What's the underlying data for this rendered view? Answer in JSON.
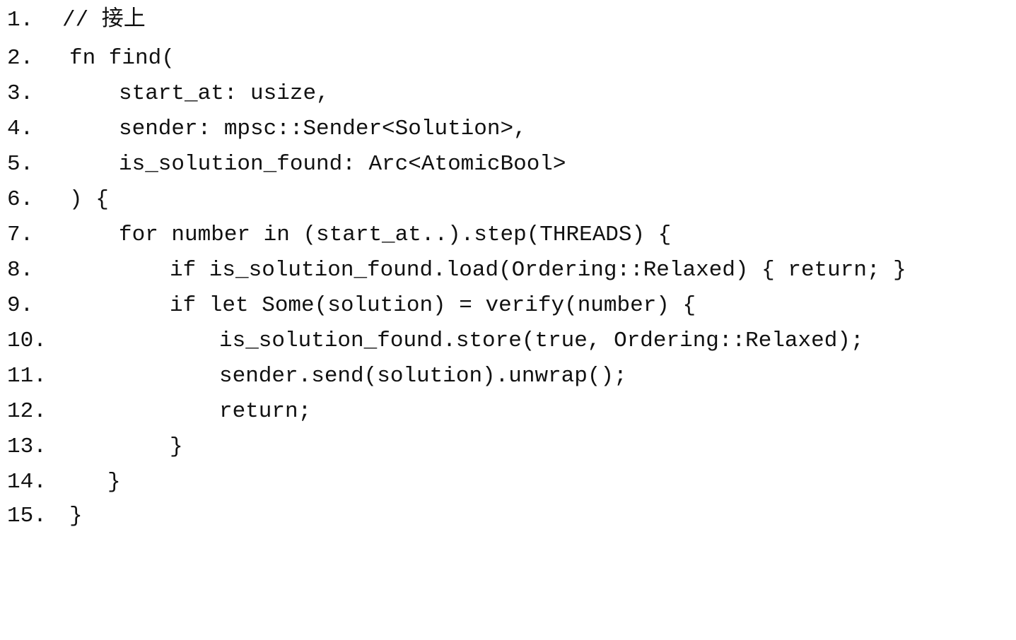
{
  "listing": {
    "lines": [
      {
        "number": "1.",
        "code": "// 接上"
      },
      {
        "number": "2.",
        "code": "fn find("
      },
      {
        "number": "3.",
        "code": "start_at: usize,"
      },
      {
        "number": "4.",
        "code": "sender: mpsc::Sender<Solution>,"
      },
      {
        "number": "5.",
        "code": "is_solution_found: Arc<AtomicBool>"
      },
      {
        "number": "6.",
        "code": ") {"
      },
      {
        "number": "7.",
        "code": "for number in (start_at..).step(THREADS) {"
      },
      {
        "number": "8.",
        "code": "if is_solution_found.load(Ordering::Relaxed) { return; }"
      },
      {
        "number": "9.",
        "code": "if let Some(solution) = verify(number) {"
      },
      {
        "number": "10.",
        "code": "is_solution_found.store(true, Ordering::Relaxed);"
      },
      {
        "number": "11.",
        "code": "sender.send(solution).unwrap();"
      },
      {
        "number": "12.",
        "code": "return;"
      },
      {
        "number": "13.",
        "code": "}"
      },
      {
        "number": "14.",
        "code": "}"
      },
      {
        "number": "15.",
        "code": "}"
      }
    ]
  }
}
